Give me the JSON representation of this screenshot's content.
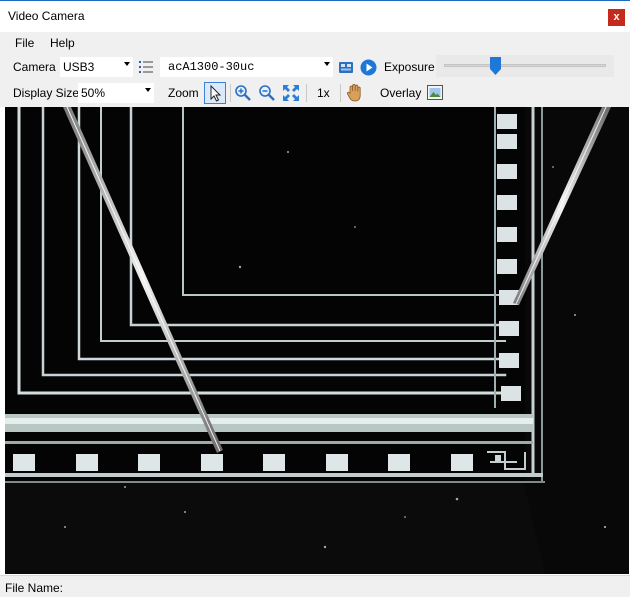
{
  "window": {
    "title": "Video Camera",
    "close_glyph": "x"
  },
  "menu": {
    "items": [
      "File",
      "Help"
    ]
  },
  "camera_toolbar": {
    "camera_label": "Camera",
    "camera_type": "USB3",
    "camera_model": "acA1300-30uc",
    "exposure_label": "Exposure",
    "exposure_level": 0.32
  },
  "view_toolbar": {
    "display_size_label": "Display Size",
    "display_size_value": "50%",
    "zoom_label": "Zoom",
    "zoom_factor": "1x",
    "overlay_label": "Overlay"
  },
  "status": {
    "file_name_label": "File Name:"
  },
  "icons": {
    "list": "list-icon",
    "config": "camera-config-icon",
    "play": "play-icon",
    "pointer": "pointer-icon",
    "zoom_in": "zoom-in-icon",
    "zoom_out": "zoom-out-icon",
    "fit": "zoom-fit-icon",
    "hand": "hand-pan-icon",
    "overlay": "overlay-image-icon"
  },
  "colors": {
    "accent": "#1e78d7",
    "close": "#c42b1c",
    "video_bg": "#040404"
  }
}
